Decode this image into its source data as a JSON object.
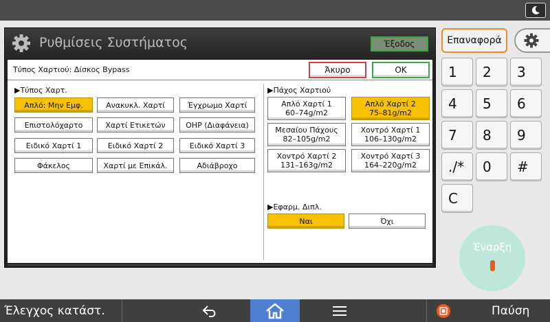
{
  "panel": {
    "title": "Ρυθμίσεις Συστήματος",
    "exit_label": "Έξοδος",
    "subheader": "Τύπος Χαρτιού: Δίσκος Bypass",
    "cancel_label": "Άκυρο",
    "ok_label": "OK"
  },
  "paper_type": {
    "label": "▶Τύπος Χαρτ.",
    "options": [
      "Απλό: Μην Εμφ.",
      "Ανακυκλ. Χαρτί",
      "Έγχρωμο Χαρτί",
      "Επιστολόχαρτο",
      "Χαρτί Ετικετών",
      "OHP (Διαφάνεια)",
      "Ειδικό Χαρτί 1",
      "Ειδικό Χαρτί 2",
      "Ειδικό Χαρτί 3",
      "Φάκελος",
      "Χαρτί με Επικάλ.",
      "Αδιάβροχο"
    ],
    "selected_index": 0
  },
  "thickness": {
    "label": "▶Πάχος Χαρτιού",
    "options": [
      {
        "line1": "Απλό Χαρτί 1",
        "line2": "60–74g/m2"
      },
      {
        "line1": "Απλό Χαρτί 2",
        "line2": "75–81g/m2"
      },
      {
        "line1": "Μεσαίου Πάχους",
        "line2": "82–105g/m2"
      },
      {
        "line1": "Χοντρό Χαρτί 1",
        "line2": "106–130g/m2"
      },
      {
        "line1": "Χοντρό Χαρτί 2",
        "line2": "131–163g/m2"
      },
      {
        "line1": "Χοντρό Χαρτί 3",
        "line2": "164–220g/m2"
      }
    ],
    "selected_index": 1
  },
  "duplex": {
    "label": "▶Εφαρμ. Διπλ.",
    "yes_label": "Ναι",
    "no_label": "Όχι",
    "selected": "yes"
  },
  "right": {
    "reset_label": "Επαναφορά",
    "keys": [
      "1",
      "2",
      "3",
      "4",
      "5",
      "6",
      "7",
      "8",
      "9",
      "./*",
      "0",
      "#",
      "C"
    ],
    "start_label": "Έναρξη"
  },
  "bottom": {
    "status_label": "Έλεγχος κατάστ.",
    "pause_label": "Παύση"
  },
  "colors": {
    "selected": "#f7c000",
    "ok_border": "#3aa84a",
    "cancel_border": "#d04040",
    "reset_border": "#f08a28",
    "home_bg": "#4f7fd0",
    "start_bg": "#bfe8dd"
  },
  "icons": {
    "night_mode": "moon-icon",
    "settings": "gear-icon",
    "back": "back-arrow-icon",
    "home": "home-icon",
    "menu": "menu-icon",
    "pause": "stop-icon"
  }
}
